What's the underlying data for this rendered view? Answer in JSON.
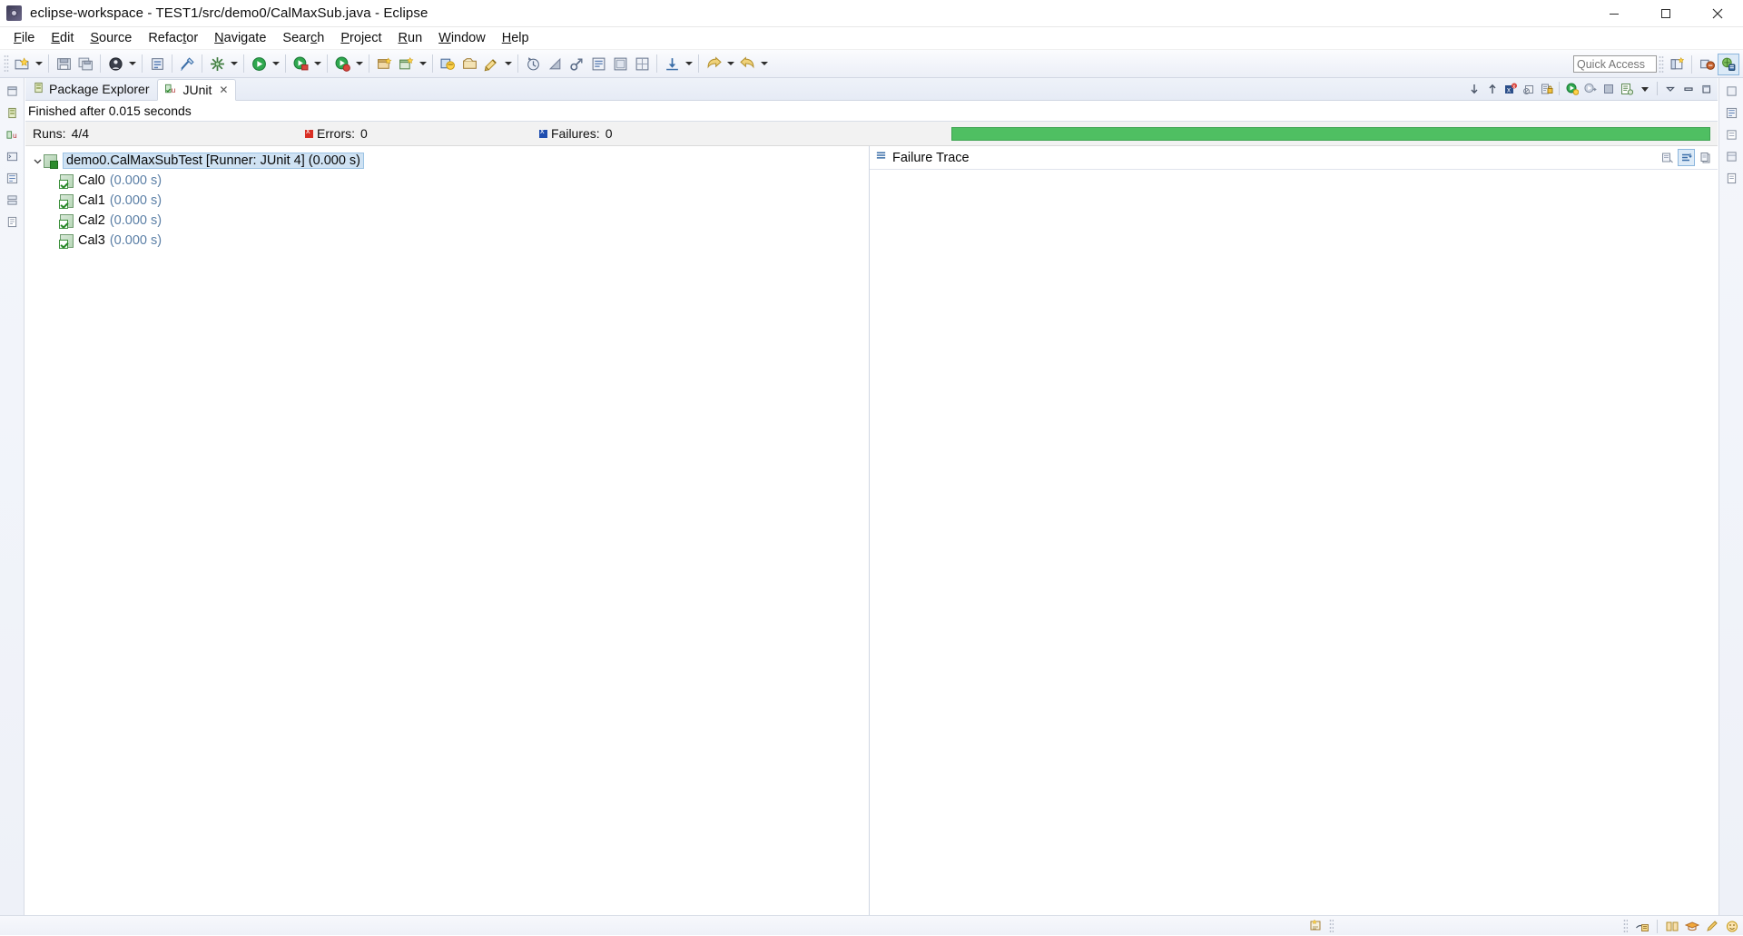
{
  "window": {
    "title": "eclipse-workspace - TEST1/src/demo0/CalMaxSub.java - Eclipse",
    "app_icon": "eclipse-icon",
    "minimize_label": "Minimize",
    "maximize_label": "Maximize",
    "close_label": "Close"
  },
  "menubar": {
    "items": [
      {
        "label": "File",
        "mnemonic": "F"
      },
      {
        "label": "Edit",
        "mnemonic": "E"
      },
      {
        "label": "Source",
        "mnemonic": "S"
      },
      {
        "label": "Refactor",
        "mnemonic": "t"
      },
      {
        "label": "Navigate",
        "mnemonic": "N"
      },
      {
        "label": "Search",
        "mnemonic": "c"
      },
      {
        "label": "Project",
        "mnemonic": "P"
      },
      {
        "label": "Run",
        "mnemonic": "R"
      },
      {
        "label": "Window",
        "mnemonic": "W"
      },
      {
        "label": "Help",
        "mnemonic": "H"
      }
    ]
  },
  "toolbar": {
    "groups": [
      {
        "buttons": [
          {
            "icon": "new-wizard-icon",
            "dropdown": true
          }
        ]
      },
      {
        "buttons": [
          {
            "icon": "save-icon",
            "dropdown": false
          },
          {
            "icon": "save-all-icon",
            "dropdown": false
          }
        ]
      },
      {
        "buttons": [
          {
            "icon": "debug-icon",
            "dropdown": true
          }
        ]
      },
      {
        "buttons": [
          {
            "icon": "new-java-class-icon",
            "dropdown": false
          }
        ]
      },
      {
        "buttons": [
          {
            "icon": "toggle-mark-occurrences-icon",
            "dropdown": false
          }
        ]
      },
      {
        "buttons": [
          {
            "icon": "external-tools-icon",
            "dropdown": true
          }
        ]
      },
      {
        "buttons": [
          {
            "icon": "run-last-tool-icon",
            "dropdown": true
          },
          {
            "icon": "debug-last-icon",
            "dropdown": true
          },
          {
            "icon": "run-icon",
            "dropdown": true
          }
        ]
      },
      {
        "buttons": [
          {
            "icon": "new-java-project-icon",
            "dropdown": false
          },
          {
            "icon": "new-package-icon",
            "dropdown": true
          }
        ]
      },
      {
        "buttons": [
          {
            "icon": "open-type-icon",
            "dropdown": false
          },
          {
            "icon": "open-task-icon",
            "dropdown": false
          },
          {
            "icon": "search-icon",
            "dropdown": true
          }
        ]
      },
      {
        "buttons": [
          {
            "icon": "history-icon",
            "dropdown": false
          },
          {
            "icon": "pin-editor-icon",
            "dropdown": false
          },
          {
            "icon": "link-icon",
            "dropdown": false
          },
          {
            "icon": "editor-outline-icon",
            "dropdown": false
          },
          {
            "icon": "ruler-icon",
            "dropdown": false
          },
          {
            "icon": "grid-icon",
            "dropdown": false
          }
        ]
      },
      {
        "buttons": [
          {
            "icon": "download-icon",
            "dropdown": true
          }
        ]
      },
      {
        "buttons": [
          {
            "icon": "back-nav-icon",
            "dropdown": true
          },
          {
            "icon": "forward-nav-icon",
            "dropdown": true
          }
        ]
      }
    ],
    "quick_access_placeholder": "Quick Access",
    "perspective_buttons": [
      {
        "icon": "open-perspective-icon"
      },
      {
        "icon": "java-perspective-icon"
      },
      {
        "icon": "java-ee-perspective-icon"
      }
    ]
  },
  "junit_view": {
    "tabs": [
      {
        "label": "Package Explorer",
        "icon": "package-explorer-icon",
        "active": false,
        "closable": false
      },
      {
        "label": "JUnit",
        "icon": "junit-icon",
        "active": true,
        "closable": true
      }
    ],
    "view_toolbar": [
      {
        "icon": "next-failure-icon"
      },
      {
        "icon": "previous-failure-icon"
      },
      {
        "icon": "show-failures-only-icon"
      },
      {
        "icon": "show-ignored-icon"
      },
      {
        "icon": "scroll-lock-icon"
      },
      {
        "icon": "rerun-test-icon"
      },
      {
        "icon": "rerun-failed-icon"
      },
      {
        "icon": "stop-icon"
      },
      {
        "icon": "test-run-history-icon"
      },
      {
        "icon": "view-menu-icon"
      },
      {
        "icon": "minimize-view-icon"
      },
      {
        "icon": "maximize-view-icon"
      }
    ],
    "status_text": "Finished after 0.015 seconds",
    "counters": {
      "runs_label": "Runs:",
      "runs_value": "4/4",
      "errors_label": "Errors:",
      "errors_value": "0",
      "failures_label": "Failures:",
      "failures_value": "0",
      "progress_color": "#4fbf62",
      "progress_percent": 100
    },
    "tree": {
      "root": {
        "label": "demo0.CalMaxSubTest [Runner: JUnit 4]",
        "time": "(0.000 s)",
        "expanded": true,
        "selected": true,
        "icon": "test-suite-passed-icon"
      },
      "children": [
        {
          "label": "Cal0",
          "time": "(0.000 s)",
          "icon": "test-case-passed-icon"
        },
        {
          "label": "Cal1",
          "time": "(0.000 s)",
          "icon": "test-case-passed-icon"
        },
        {
          "label": "Cal2",
          "time": "(0.000 s)",
          "icon": "test-case-passed-icon"
        },
        {
          "label": "Cal3",
          "time": "(0.000 s)",
          "icon": "test-case-passed-icon"
        }
      ]
    },
    "failure_trace": {
      "title": "Failure Trace",
      "icon": "failure-trace-icon",
      "content": "",
      "tools": [
        {
          "icon": "compare-result-icon"
        },
        {
          "icon": "filter-stack-trace-icon"
        },
        {
          "icon": "copy-trace-icon"
        }
      ]
    }
  },
  "left_rail": {
    "icons": [
      "restore-icon",
      "package-explorer-min-icon",
      "junit-min-icon",
      "console-icon",
      "outline-icon",
      "servers-icon",
      "task-list-icon"
    ]
  },
  "right_rail": {
    "icons": [
      "maximize-rail-icon",
      "outline-rail-icon",
      "task-rail-icon",
      "properties-rail-icon",
      "snippets-rail-icon"
    ]
  },
  "statusbar": {
    "left_icons": [
      "smart-insert-icon"
    ],
    "right_icons": [
      "writable-icon",
      "book-icon",
      "graduation-icon",
      "pencil-icon",
      "smiley-icon"
    ]
  },
  "colors": {
    "pass_green": "#4fbf62",
    "selection_blue": "#cfe2f3",
    "error_red": "#d93025",
    "failure_blue": "#1f4eb0",
    "time_text": "#5b7fa6"
  }
}
